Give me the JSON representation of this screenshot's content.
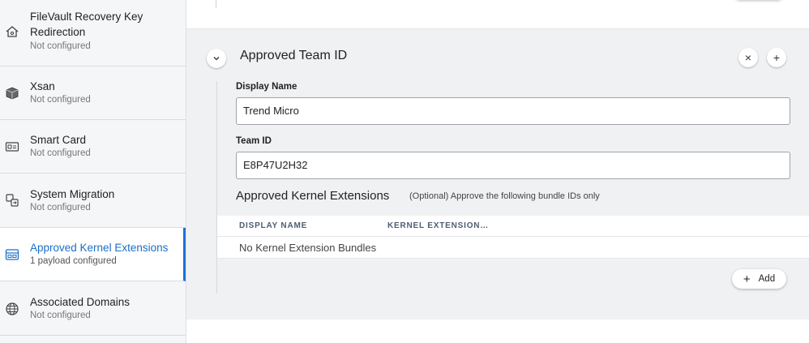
{
  "sidebar": {
    "items": [
      {
        "title_line1": "FileVault Recovery Key",
        "title_line2": "Redirection",
        "subtitle": "Not configured",
        "icon": "house-key-icon"
      },
      {
        "title": "Xsan",
        "subtitle": "Not configured",
        "icon": "xsan-drive-icon"
      },
      {
        "title": "Smart Card",
        "subtitle": "Not configured",
        "icon": "smart-card-icon"
      },
      {
        "title": "System Migration",
        "subtitle": "Not configured",
        "icon": "migration-icon"
      },
      {
        "title": "Approved Kernel Extensions",
        "subtitle": "1 payload configured",
        "icon": "kernel-extension-icon",
        "active": true
      },
      {
        "title": "Associated Domains",
        "subtitle": "Not configured",
        "icon": "globe-icon"
      }
    ]
  },
  "panel": {
    "title": "Approved Team ID",
    "remove_symbol": "×",
    "add_symbol": "+",
    "display_name_label": "Display Name",
    "display_name_value": "Trend Micro",
    "team_id_label": "Team ID",
    "team_id_value": "E8P47U2H32",
    "section_title": "Approved Kernel Extensions",
    "section_subtitle": "(Optional) Approve the following bundle IDs only",
    "table": {
      "columns": [
        "DISPLAY NAME",
        "KERNEL EXTENSION…"
      ],
      "empty_text": "No Kernel Extension Bundles"
    },
    "add_button": {
      "symbol": "+",
      "label": "Add"
    }
  },
  "colors": {
    "accent": "#1a73d9",
    "panel_bg": "#f0f1f3",
    "sidebar_bg": "#f5f6f8"
  }
}
